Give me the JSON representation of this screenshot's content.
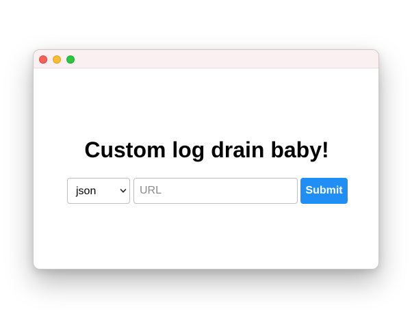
{
  "window": {
    "controls": [
      "close",
      "minimize",
      "zoom"
    ],
    "titlebar_color": "#fbf0f1"
  },
  "main": {
    "heading": "Custom log drain baby!",
    "format_select": {
      "selected": "json",
      "icon": "chevron-down-icon"
    },
    "url_input": {
      "value": "",
      "placeholder": "URL"
    },
    "submit_label": "Submit"
  },
  "colors": {
    "accent": "#1f8ff5",
    "close": "#fe5f57",
    "minimize": "#febc2e",
    "zoom": "#28c840"
  }
}
